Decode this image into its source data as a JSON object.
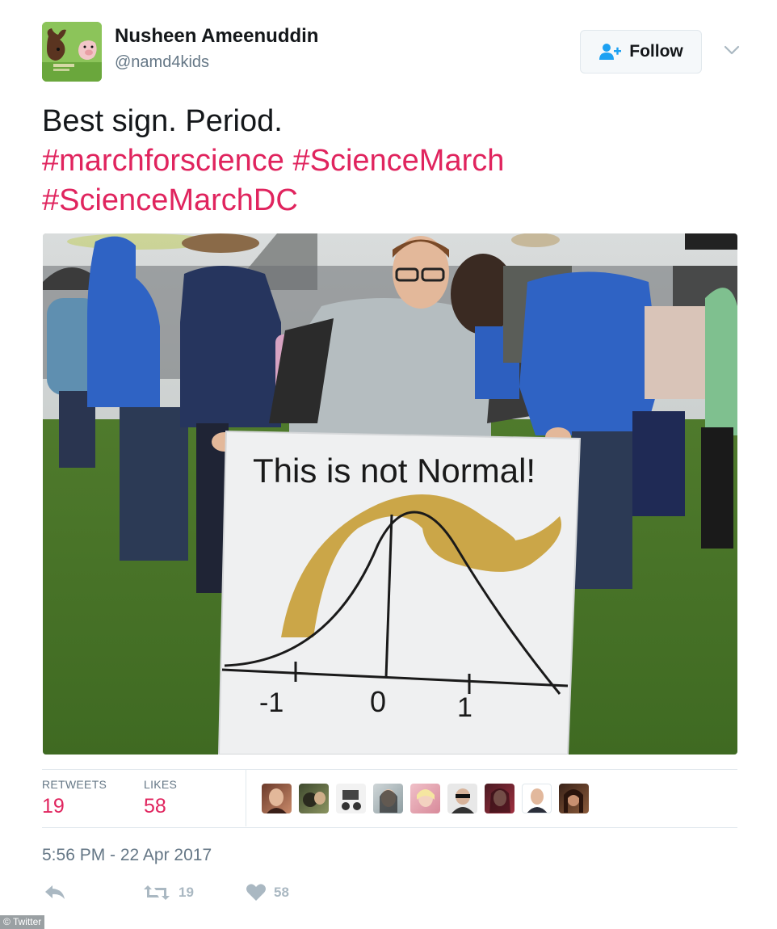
{
  "user": {
    "display_name": "Nusheen Ameenuddin",
    "handle": "@namd4kids",
    "avatar_icon": "moose-pig-avatar"
  },
  "follow": {
    "label": "Follow",
    "icon": "add-user-icon"
  },
  "menu": {
    "icon": "chevron-down-icon"
  },
  "tweet": {
    "text": "Best sign. Period.",
    "hashtags": [
      "#marchforscience",
      "#ScienceMarch",
      "#ScienceMarchDC"
    ]
  },
  "photo": {
    "sign_title": "This is not Normal!",
    "sign_ticks": [
      "-1",
      "0",
      "1"
    ]
  },
  "stats": {
    "retweets_label": "RETWEETS",
    "retweets": "19",
    "likes_label": "LIKES",
    "likes": "58"
  },
  "likers_count": 9,
  "timestamp": "5:56 PM - 22 Apr 2017",
  "actions": {
    "reply_icon": "reply-icon",
    "retweet_icon": "retweet-icon",
    "retweet_count": "19",
    "like_icon": "heart-icon",
    "like_count": "58"
  },
  "credit": "© Twitter",
  "colors": {
    "accent": "#e0245e",
    "text": "#14171a",
    "muted": "#657786",
    "action_grey": "#aab8c2"
  }
}
